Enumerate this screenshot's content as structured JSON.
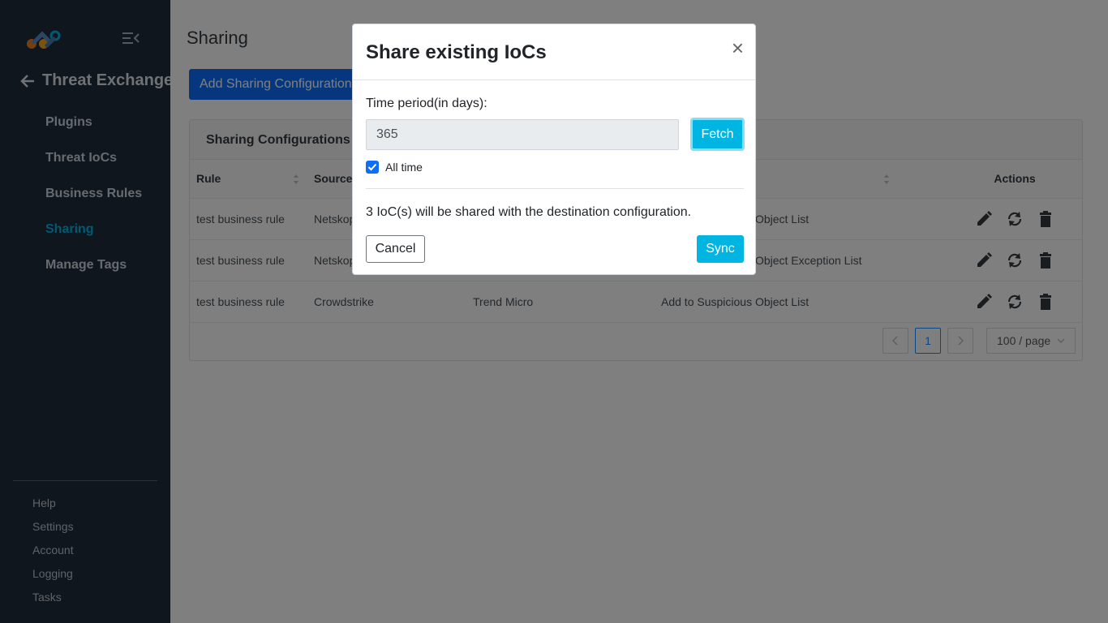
{
  "sidebar": {
    "back_title": "Threat Exchange",
    "nav": [
      {
        "label": "Plugins"
      },
      {
        "label": "Threat IoCs"
      },
      {
        "label": "Business Rules"
      },
      {
        "label": "Sharing",
        "active": true
      },
      {
        "label": "Manage Tags"
      }
    ],
    "footer": [
      {
        "label": "Help"
      },
      {
        "label": "Settings"
      },
      {
        "label": "Account"
      },
      {
        "label": "Logging"
      },
      {
        "label": "Tasks"
      }
    ]
  },
  "main": {
    "page_title": "Sharing",
    "add_button": "Add Sharing Configuration",
    "card_title": "Sharing Configurations",
    "columns": {
      "rule": "Rule",
      "source": "Source",
      "actions": "Actions"
    },
    "rows": [
      {
        "rule": "test business rule",
        "source": "Netskope",
        "destination": "",
        "action": "Add to Suspicious Object List"
      },
      {
        "rule": "test business rule",
        "source": "Netskope",
        "destination": "",
        "action": "Add to Suspicious Object Exception List"
      },
      {
        "rule": "test business rule",
        "source": "Crowdstrike",
        "destination": "Trend Micro",
        "action": "Add to Suspicious Object List"
      }
    ],
    "pagination": {
      "current_page": "1",
      "page_size": "100 / page"
    }
  },
  "modal": {
    "title": "Share existing IoCs",
    "close": "×",
    "field_label": "Time period(in days):",
    "period_value": "365",
    "fetch_button": "Fetch",
    "all_time_label": "All time",
    "all_time_checked": true,
    "info_text": "3 IoC(s) will be shared with the destination configuration.",
    "cancel_button": "Cancel",
    "sync_button": "Sync"
  },
  "colors": {
    "sidebar_bg": "#1f2d3d",
    "accent": "#00b5e2",
    "primary": "#0d6efd"
  }
}
